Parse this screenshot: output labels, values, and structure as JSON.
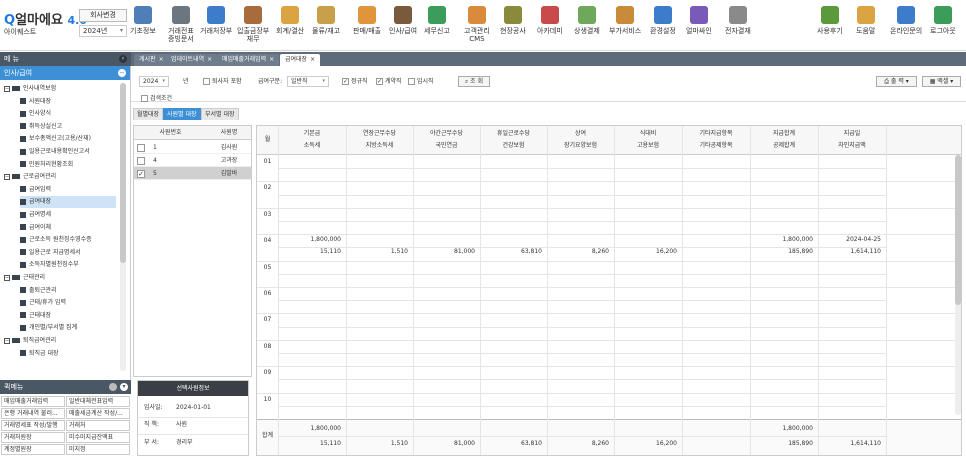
{
  "app": {
    "logo_prefix": "얼마에요",
    "logo_version": "4.0",
    "company": "아이퀘스트",
    "change_company": "회사변경",
    "year": "2024년"
  },
  "toolbar": [
    {
      "label": "기초정보",
      "icon": "basic-info-icon",
      "color": "#4f7fb8"
    },
    {
      "label": "거래전표\n증빙문서",
      "icon": "voucher-icon",
      "color": "#6b7680"
    },
    {
      "label": "거래처장부",
      "icon": "ledger-icon",
      "color": "#3d7cc9"
    },
    {
      "label": "입출금장부\n재무",
      "icon": "cash-book-icon",
      "color": "#a86b3c"
    },
    {
      "label": "회계/결산",
      "icon": "accounting-icon",
      "color": "#d9a441"
    },
    {
      "label": "물류/재고",
      "icon": "inventory-icon",
      "color": "#c9a04a"
    },
    {
      "label": "판매/매출",
      "icon": "sales-icon",
      "color": "#e0953a"
    },
    {
      "label": "인사/급여",
      "icon": "hr-icon",
      "color": "#7a5a3c"
    },
    {
      "label": "세무신고",
      "icon": "tax-icon",
      "color": "#3c9d5a"
    },
    {
      "label": "고객관리\nCMS",
      "icon": "cms-icon",
      "color": "#d98a3a"
    },
    {
      "label": "현장공사",
      "icon": "construction-icon",
      "color": "#8a8a3c"
    },
    {
      "label": "아카데미",
      "icon": "academy-icon",
      "color": "#c94a4a"
    },
    {
      "label": "상생결제",
      "icon": "payment-icon",
      "color": "#6fa85a"
    },
    {
      "label": "부가서비스",
      "icon": "extra-service-icon",
      "color": "#c98a3a"
    },
    {
      "label": "환경설정",
      "icon": "settings-icon",
      "color": "#3d7cc9"
    },
    {
      "label": "얼마싸인",
      "icon": "sign-icon",
      "color": "#7a5ab8"
    },
    {
      "label": "전자결재",
      "icon": "approval-icon",
      "color": "#8a8a8a"
    },
    {
      "label": "사용후기",
      "icon": "review-icon",
      "color": "#5a9a3c"
    },
    {
      "label": "도움말",
      "icon": "help-icon",
      "color": "#d9a441"
    },
    {
      "label": "온라인문의",
      "icon": "inquiry-icon",
      "color": "#3d7cc9"
    },
    {
      "label": "로그아웃",
      "icon": "logout-icon",
      "color": "#3c9d5a"
    }
  ],
  "menu_header": "메 뉴",
  "tabs": [
    "게시판",
    "업데이트내역",
    "매입매출거래입력",
    "급여대장"
  ],
  "sidebar": {
    "section": "인사/급여",
    "items": [
      {
        "label": "인사내역보험",
        "kind": "folder"
      },
      {
        "label": "사원대장",
        "kind": "file"
      },
      {
        "label": "인사양식",
        "kind": "file"
      },
      {
        "label": "취득상실신고",
        "kind": "file"
      },
      {
        "label": "보수총액신고(고용/산재)",
        "kind": "file"
      },
      {
        "label": "일용근로내용확인신고서",
        "kind": "file"
      },
      {
        "label": "민원처리현황조회",
        "kind": "file"
      },
      {
        "label": "근로급여관리",
        "kind": "folder"
      },
      {
        "label": "급여입력",
        "kind": "file"
      },
      {
        "label": "급여대장",
        "kind": "file",
        "selected": true
      },
      {
        "label": "급여명세",
        "kind": "file"
      },
      {
        "label": "급여이체",
        "kind": "file"
      },
      {
        "label": "근로소득 원천징수영수증",
        "kind": "file"
      },
      {
        "label": "일용근로 지급명세서",
        "kind": "file"
      },
      {
        "label": "소득자별원천징수부",
        "kind": "file"
      },
      {
        "label": "근태관리",
        "kind": "folder"
      },
      {
        "label": "출퇴근관리",
        "kind": "file"
      },
      {
        "label": "근태/휴가 입력",
        "kind": "file"
      },
      {
        "label": "근태대장",
        "kind": "file"
      },
      {
        "label": "개인별/부서별 집계",
        "kind": "file"
      },
      {
        "label": "퇴직급여관리",
        "kind": "folder"
      },
      {
        "label": "퇴직금 대장",
        "kind": "file"
      }
    ]
  },
  "quick_menu": {
    "title": "퀵메뉴",
    "items": [
      "매입매출거래입력",
      "일반대체전표입력",
      "은행 거래내역 불러...",
      "매출세금계산 작성/...",
      "거래명세표 작성/발행",
      "거래처",
      "거래처원장",
      "미수미지급잔액표",
      "계정별원장",
      "미지정"
    ]
  },
  "filters": {
    "year": "2024",
    "year_unit": "년",
    "exclude_resigned": "퇴사자 포함",
    "pay_type_label": "급여구분:",
    "pay_type": "일반직",
    "regular": "정규직",
    "contract": "계약직",
    "temp": "임시직",
    "search": "조 회",
    "search_condition": "검색조건",
    "print": "출 력",
    "excel": "엑셀"
  },
  "subtabs": [
    "월별대장",
    "사원별 대장",
    "부서별 대장"
  ],
  "employee_table": {
    "headers": [
      "사원번호",
      "사원명"
    ],
    "rows": [
      {
        "no": "1",
        "name": "김사원",
        "checked": false,
        "selected": false
      },
      {
        "no": "4",
        "name": "고과장",
        "checked": false,
        "selected": false
      },
      {
        "no": "5",
        "name": "김발바",
        "checked": true,
        "selected": true
      }
    ]
  },
  "selected_info": {
    "title": "선택사원정보",
    "hire_label": "입사일:",
    "hire_date": "2024-01-01",
    "position_label": "직 책:",
    "position": "사원",
    "dept_label": "부 서:",
    "dept": "경리부"
  },
  "grid": {
    "month_header": "월",
    "headers_top": [
      "기본급",
      "연장근무수당",
      "야간근무수당",
      "휴일근로수당",
      "상여",
      "식대비",
      "기타지급항목",
      "지급합계",
      "지급일"
    ],
    "headers_bottom": [
      "소득세",
      "지방소득세",
      "국민연금",
      "건강보험",
      "장기요양보험",
      "고용보험",
      "기타공제항목",
      "공제합계",
      "차인지급액"
    ],
    "months": [
      "01",
      "02",
      "03",
      "04",
      "05",
      "06",
      "07",
      "08",
      "09",
      "10"
    ],
    "april_top": {
      "c0": "1,800,000",
      "c7": "1,800,000",
      "c8": "2024-04-25"
    },
    "april_bottom": [
      "15,110",
      "1,510",
      "81,000",
      "63,810",
      "8,260",
      "16,200",
      "",
      "185,890",
      "1,614,110"
    ],
    "total_label": "합계",
    "total_top": {
      "c0": "1,800,000",
      "c7": "1,800,000"
    },
    "total_bottom": [
      "15,110",
      "1,510",
      "81,000",
      "63,810",
      "8,260",
      "16,200",
      "",
      "185,890",
      "1,614,110"
    ]
  }
}
